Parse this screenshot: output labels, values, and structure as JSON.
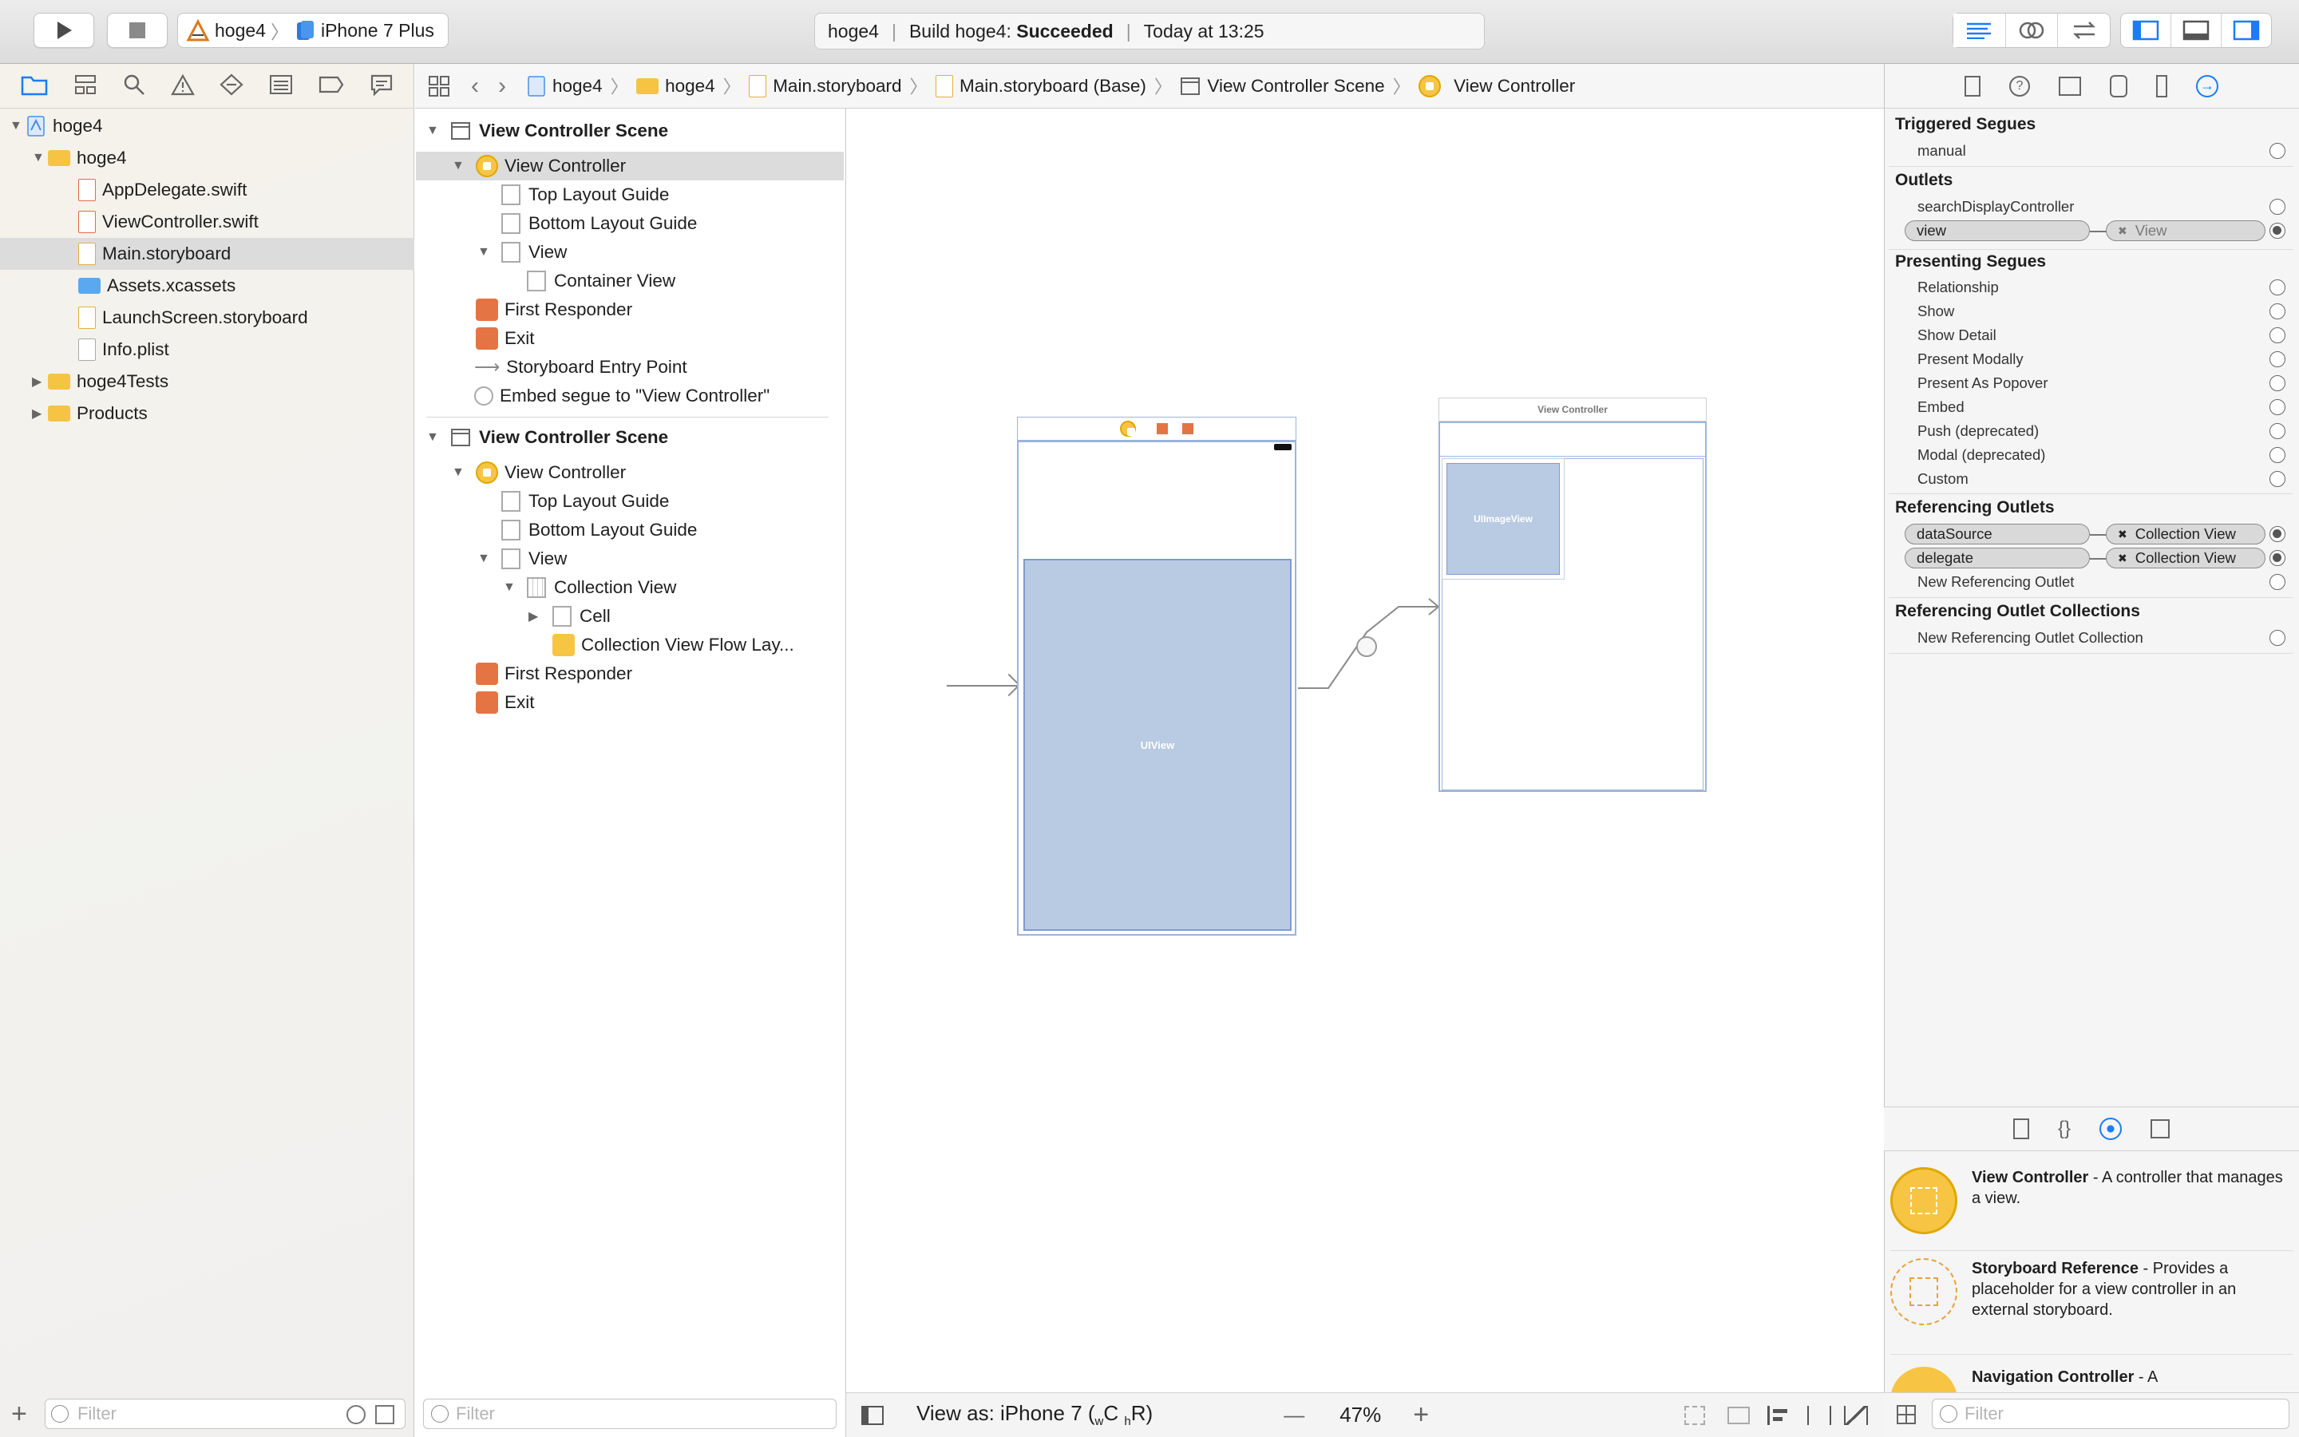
{
  "toolbar": {
    "scheme_project": "hoge4",
    "scheme_device": "iPhone 7 Plus",
    "activity_project": "hoge4",
    "activity_build_prefix": "Build hoge4:",
    "activity_build_status": "Succeeded",
    "activity_time": "Today at 13:25"
  },
  "navigator": {
    "items": [
      {
        "label": "hoge4"
      },
      {
        "label": "hoge4"
      },
      {
        "label": "AppDelegate.swift"
      },
      {
        "label": "ViewController.swift"
      },
      {
        "label": "Main.storyboard"
      },
      {
        "label": "Assets.xcassets"
      },
      {
        "label": "LaunchScreen.storyboard"
      },
      {
        "label": "Info.plist"
      },
      {
        "label": "hoge4Tests"
      },
      {
        "label": "Products"
      }
    ],
    "filter_placeholder": "Filter"
  },
  "jumpbar": {
    "crumbs": [
      "hoge4",
      "hoge4",
      "Main.storyboard",
      "Main.storyboard (Base)",
      "View Controller Scene",
      "View Controller"
    ]
  },
  "outline": {
    "scene1": {
      "title": "View Controller Scene",
      "items": [
        "View Controller",
        "Top Layout Guide",
        "Bottom Layout Guide",
        "View",
        "Container View",
        "First Responder",
        "Exit",
        "Storyboard Entry Point",
        "Embed segue to \"View Controller\""
      ]
    },
    "scene2": {
      "title": "View Controller Scene",
      "items": [
        "View Controller",
        "Top Layout Guide",
        "Bottom Layout Guide",
        "View",
        "Collection View",
        "Cell",
        "Collection View Flow Lay...",
        "First Responder",
        "Exit"
      ]
    },
    "filter_placeholder": "Filter"
  },
  "canvas": {
    "uiview_label": "UIView",
    "vc_title": "View Controller",
    "imageview_label": "UIImageView",
    "view_as": "View as: iPhone 7 (",
    "size_w": "w",
    "size_c": "C",
    "size_h": "h",
    "size_r": "R)",
    "zoom": "47%",
    "zoom_minus": "—",
    "zoom_plus": "+"
  },
  "inspector": {
    "triggered_segues": "Triggered Segues",
    "manual": "manual",
    "outlets": "Outlets",
    "search_display_controller": "searchDisplayController",
    "view_outlet": "view",
    "view_target": "View",
    "presenting_segues": "Presenting Segues",
    "segues": [
      "Relationship",
      "Show",
      "Show Detail",
      "Present Modally",
      "Present As Popover",
      "Embed",
      "Push (deprecated)",
      "Modal (deprecated)",
      "Custom"
    ],
    "referencing_outlets": "Referencing Outlets",
    "datasource": "dataSource",
    "delegate": "delegate",
    "collection_view": "Collection View",
    "new_referencing_outlet": "New Referencing Outlet",
    "referencing_outlet_collections": "Referencing Outlet Collections",
    "new_referencing_outlet_collection": "New Referencing Outlet Collection"
  },
  "library": {
    "items": [
      {
        "title": "View Controller",
        "desc": " - A controller that manages a view."
      },
      {
        "title": "Storyboard Reference",
        "desc": " - Provides a placeholder for a view controller in an external storyboard."
      },
      {
        "title": "Navigation Controller",
        "desc": " - A"
      }
    ],
    "filter_placeholder": "Filter"
  },
  "colors": {
    "accent": "#1b7cf4",
    "selected_scene": "#b9cae3",
    "folder": "#f5c443",
    "storyboard_icon": "#f7c543"
  }
}
